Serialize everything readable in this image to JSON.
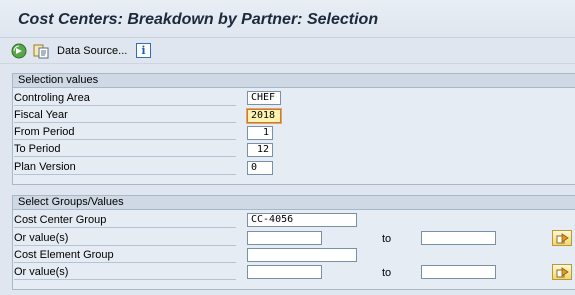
{
  "title": "Cost Centers: Breakdown by Partner: Selection",
  "toolbar": {
    "execute_icon": "execute-icon",
    "copy_icon": "get-variant-icon",
    "data_source_label": "Data Source...",
    "info_icon": "info-icon",
    "info_glyph": "i"
  },
  "selection_values": {
    "heading": "Selection values",
    "controlling_area_label": "Controling Area",
    "controlling_area_value": "CHEF",
    "fiscal_year_label": "Fiscal Year",
    "fiscal_year_value": "2018",
    "from_period_label": "From Period",
    "from_period_value": "1",
    "to_period_label": "To Period",
    "to_period_value": "12",
    "plan_version_label": "Plan Version",
    "plan_version_value": "0"
  },
  "groups_values": {
    "heading": "Select Groups/Values",
    "cost_center_group_label": "Cost Center Group",
    "cost_center_group_value": "CC-4056",
    "cc_or_values_label": "Or value(s)",
    "cc_value_from": "",
    "cc_to_label": "to",
    "cc_value_to": "",
    "cost_element_group_label": "Cost Element Group",
    "cost_element_group_value": "",
    "ce_or_values_label": "Or value(s)",
    "ce_value_from": "",
    "ce_to_label": "to",
    "ce_value_to": ""
  },
  "colors": {
    "background": "#dfe6ef",
    "highlight_field": "#fff3b0",
    "panel_header": "#cfd9e5"
  }
}
